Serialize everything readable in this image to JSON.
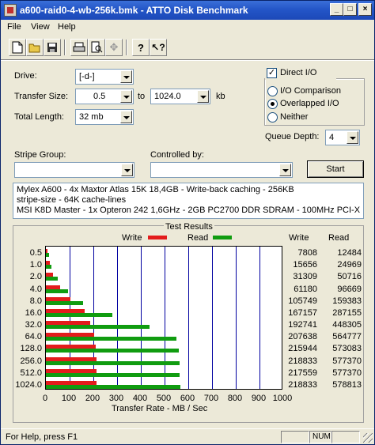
{
  "window": {
    "title": "a600-raid0-4-wb-256k.bmk - ATTO Disk Benchmark"
  },
  "menu": [
    "File",
    "View",
    "Help"
  ],
  "toolbar": {
    "icons": [
      "new-icon",
      "open-icon",
      "save-icon",
      "print-icon",
      "print-preview-icon",
      "move-icon",
      "help-icon",
      "context-help-icon"
    ]
  },
  "form": {
    "drive_label": "Drive:",
    "drive_value": "[-d-]",
    "transfer_size_label": "Transfer Size:",
    "transfer_from": "0.5",
    "transfer_to_word": "to",
    "transfer_to": "1024.0",
    "transfer_unit": "kb",
    "total_length_label": "Total Length:",
    "total_length_value": "32 mb",
    "stripe_group_label": "Stripe Group:",
    "stripe_group_value": "",
    "controlled_by_label": "Controlled by:",
    "controlled_by_value": "",
    "start_label": "Start"
  },
  "options": {
    "direct_io_label": "Direct I/O",
    "direct_io_checked": true,
    "io_comparison_label": "I/O Comparison",
    "overlapped_io_label": "Overlapped I/O",
    "neither_label": "Neither",
    "selected": "overlapped",
    "queue_depth_label": "Queue Depth:",
    "queue_depth_value": "4"
  },
  "description": [
    "Mylex A600 - 4x Maxtor Atlas 15K 18,4GB - Write-back caching - 256KB",
    "stripe-size - 64K cache-lines",
    "MSI K8D Master - 1x Opteron 242 1,6GHz - 2GB PC2700 DDR SDRAM - 100MHz PCI-X"
  ],
  "results": {
    "title": "Test Results",
    "write_legend": "Write",
    "read_legend": "Read",
    "write_header": "Write",
    "read_header": "Read",
    "x_axis_label": "Transfer Rate - MB / Sec",
    "colors": {
      "write": "#e31c1c",
      "read": "#109c10",
      "grid": "#0000a0"
    }
  },
  "chart_data": {
    "type": "bar",
    "title": "Test Results",
    "xlabel": "Transfer Rate - MB / Sec",
    "ylabel": "",
    "xlim": [
      0,
      1000
    ],
    "x_ticks": [
      0,
      100,
      200,
      300,
      400,
      500,
      600,
      700,
      800,
      900,
      1000
    ],
    "categories": [
      "0.5",
      "1.0",
      "2.0",
      "4.0",
      "8.0",
      "16.0",
      "32.0",
      "64.0",
      "128.0",
      "256.0",
      "512.0",
      "1024.0"
    ],
    "series": [
      {
        "name": "Write",
        "values": [
          7808,
          15656,
          31309,
          61180,
          105749,
          167157,
          192741,
          207638,
          215944,
          218833,
          217559,
          218833
        ]
      },
      {
        "name": "Read",
        "values": [
          12484,
          24969,
          50716,
          96669,
          159383,
          287155,
          448305,
          564777,
          573083,
          577370,
          577370,
          578813
        ]
      }
    ]
  },
  "status": {
    "text": "For Help, press F1",
    "num": "NUM"
  }
}
